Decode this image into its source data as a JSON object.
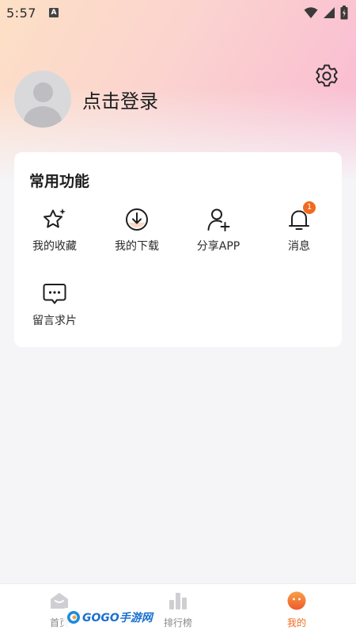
{
  "status_bar": {
    "time": "5:57",
    "notification_badge": "A",
    "icons": [
      "wifi-icon",
      "signal-icon",
      "battery-icon"
    ]
  },
  "profile": {
    "login_prompt": "点击登录"
  },
  "functions": {
    "title": "常用功能",
    "items": [
      {
        "label": "我的收藏",
        "icon": "star-sparkle-icon"
      },
      {
        "label": "我的下载",
        "icon": "download-icon"
      },
      {
        "label": "分享APP",
        "icon": "add-user-icon"
      },
      {
        "label": "消息",
        "icon": "bell-icon",
        "badge": "1"
      },
      {
        "label": "留言求片",
        "icon": "chat-bubble-icon"
      }
    ]
  },
  "tabbar": {
    "tabs": [
      {
        "label": "首页",
        "icon": "home-icon",
        "active": false
      },
      {
        "label": "排行榜",
        "icon": "ranking-icon",
        "active": false
      },
      {
        "label": "我的",
        "icon": "profile-face-icon",
        "active": true
      }
    ]
  },
  "watermark": {
    "text": "GOGO手游网"
  },
  "colors": {
    "accent": "#f06a1f",
    "gradient_start": "#fde0c6",
    "gradient_end": "#f9b9d3",
    "background": "#f5f5f7"
  }
}
